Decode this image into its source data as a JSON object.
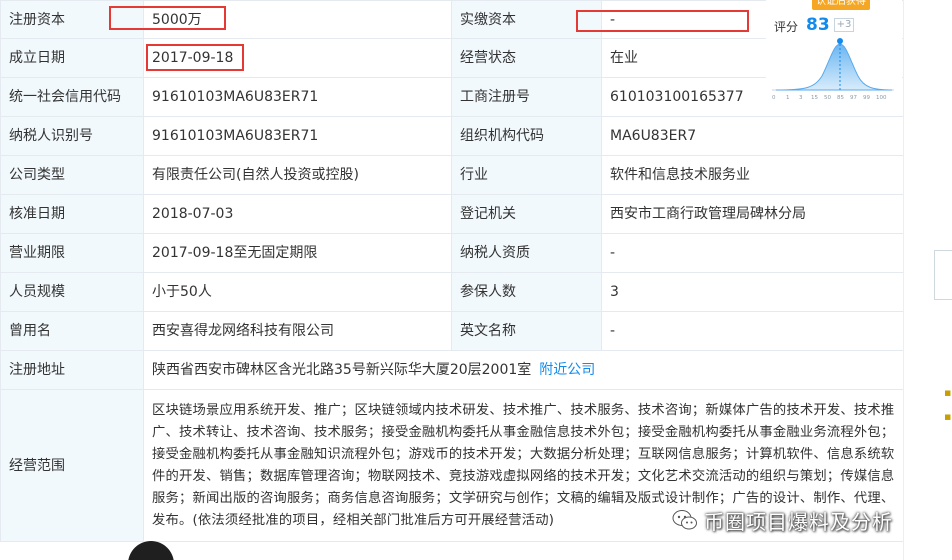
{
  "rows": [
    {
      "l1": "注册资本",
      "v1": "5000万",
      "l2": "实缴资本",
      "v2": "-"
    },
    {
      "l1": "成立日期",
      "v1": "2017-09-18",
      "l2": "经营状态",
      "v2": "在业"
    },
    {
      "l1": "统一社会信用代码",
      "v1": "91610103MA6U83ER71",
      "l2": "工商注册号",
      "v2": "610103100165377"
    },
    {
      "l1": "纳税人识别号",
      "v1": "91610103MA6U83ER71",
      "l2": "组织机构代码",
      "v2": "MA6U83ER7"
    },
    {
      "l1": "公司类型",
      "v1": "有限责任公司(自然人投资或控股)",
      "l2": "行业",
      "v2": "软件和信息技术服务业"
    },
    {
      "l1": "核准日期",
      "v1": "2018-07-03",
      "l2": "登记机关",
      "v2": "西安市工商行政管理局碑林分局"
    },
    {
      "l1": "营业期限",
      "v1": "2017-09-18至无固定期限",
      "l2": "纳税人资质",
      "v2": "-"
    },
    {
      "l1": "人员规模",
      "v1": "小于50人",
      "l2": "参保人数",
      "v2": "3"
    },
    {
      "l1": "曾用名",
      "v1": "西安喜得龙网络科技有限公司",
      "l2": "英文名称",
      "v2": "-"
    }
  ],
  "address": {
    "label": "注册地址",
    "value": "陕西省西安市碑林区含光北路35号新兴际华大厦20层2001室",
    "link": "附近公司"
  },
  "scope": {
    "label": "经营范围",
    "value": "区块链场景应用系统开发、推广；区块链领域内技术研发、技术推广、技术服务、技术咨询；新媒体广告的技术开发、技术推广、技术转让、技术咨询、技术服务；接受金融机构委托从事金融信息技术外包；接受金融机构委托从事金融业务流程外包；接受金融机构委托从事金融知识流程外包；游戏币的技术开发；大数据分析处理；互联网信息服务；计算机软件、信息系统软件的开发、销售；数据库管理咨询；物联网技术、竞技游戏虚拟网络的技术开发；文化艺术交流活动的组织与策划；传媒信息服务；新闻出版的咨询服务；商务信息咨询服务；文学研究与创作；文稿的编辑及版式设计制作；广告的设计、制作、代理、发布。(依法须经批准的项目，经相关部门批准后方可开展经营活动)"
  },
  "score_widget": {
    "badge": "认证后获得",
    "label": "评分",
    "value": "83",
    "delta": "+3",
    "axis_ticks": [
      "0",
      "1",
      "3",
      "15",
      "50",
      "85",
      "97",
      "99",
      "100"
    ]
  },
  "watermark": {
    "text": "币圈项目爆料及分析",
    "icon": "wechat-icon"
  },
  "colors": {
    "label_bg": "#f2f9fc",
    "border": "#e4eaf0",
    "accent": "#128bed",
    "highlight": "#e53935",
    "badge": "#f5a623"
  }
}
